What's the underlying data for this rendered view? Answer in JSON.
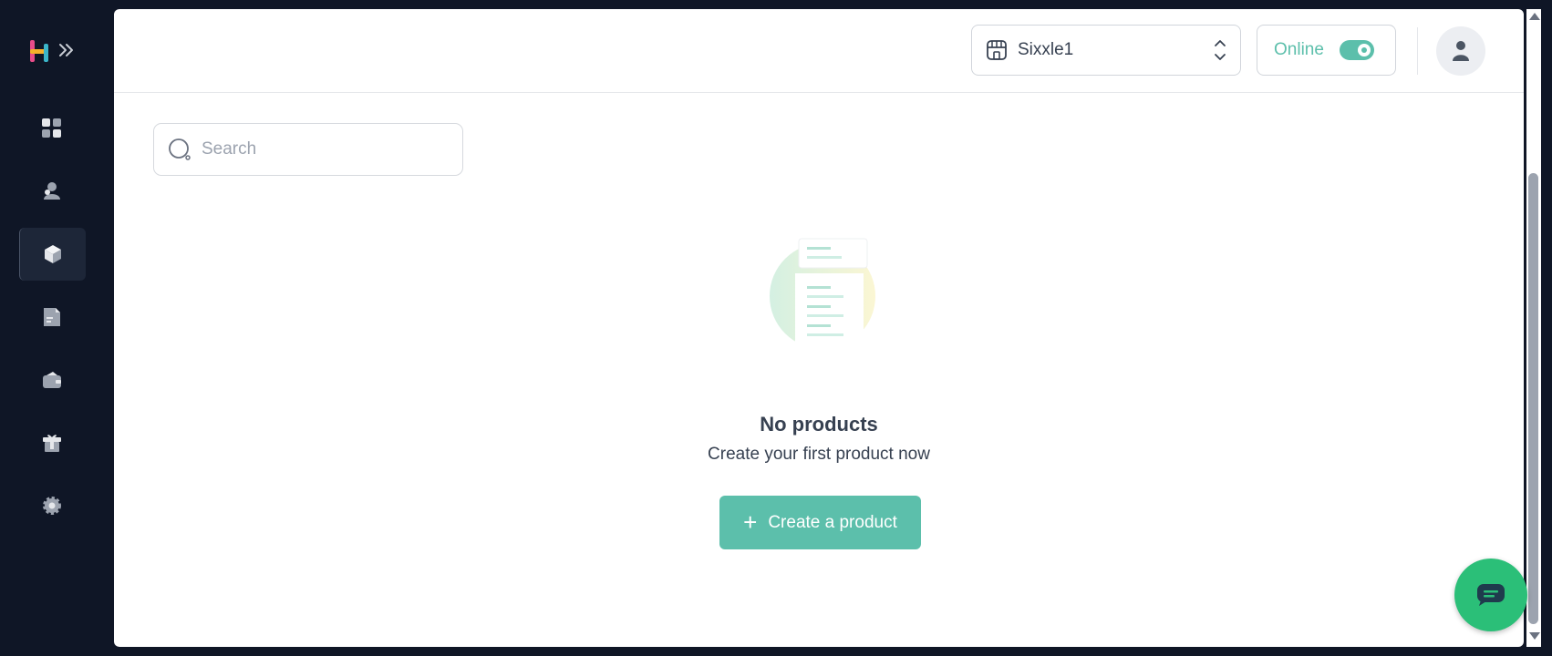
{
  "sidebar": {
    "expand_icon": "double-chevron-right-icon",
    "items": [
      {
        "name": "dashboard",
        "icon": "grid-icon",
        "active": false
      },
      {
        "name": "customers",
        "icon": "users-icon",
        "active": false
      },
      {
        "name": "products",
        "icon": "cube-icon",
        "active": true
      },
      {
        "name": "orders",
        "icon": "document-icon",
        "active": false
      },
      {
        "name": "wallet",
        "icon": "wallet-icon",
        "active": false
      },
      {
        "name": "gifts",
        "icon": "gift-icon",
        "active": false
      },
      {
        "name": "settings",
        "icon": "gear-icon",
        "active": false
      }
    ]
  },
  "header": {
    "store_name": "Sixxle1",
    "status_label": "Online",
    "status_on": true
  },
  "search": {
    "placeholder": "Search",
    "value": ""
  },
  "empty_state": {
    "title": "No products",
    "subtitle": "Create your first product now",
    "button_label": "Create a product"
  },
  "colors": {
    "sidebar_bg": "#0f1626",
    "accent": "#5cbfab",
    "chat": "#2bbf78"
  }
}
